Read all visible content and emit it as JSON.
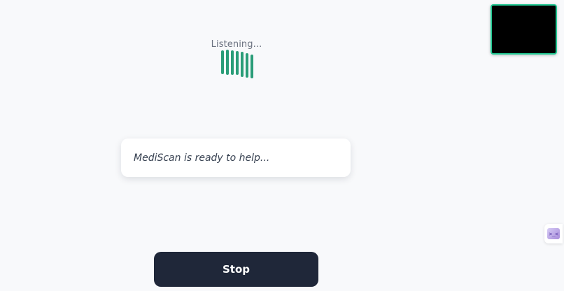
{
  "status": {
    "listening_text": "Listening...",
    "bar_color": "#2a9d78",
    "bar_count": 7
  },
  "camera": {
    "border_color": "#22c993",
    "background": "#000000"
  },
  "message": {
    "text": "MediScan is ready to help..."
  },
  "side_tab": {
    "glyph": ">_<"
  },
  "controls": {
    "stop_label": "Stop"
  },
  "colors": {
    "page_background": "#f8f9fb",
    "button_background": "#1f2739",
    "button_text": "#ffffff"
  }
}
